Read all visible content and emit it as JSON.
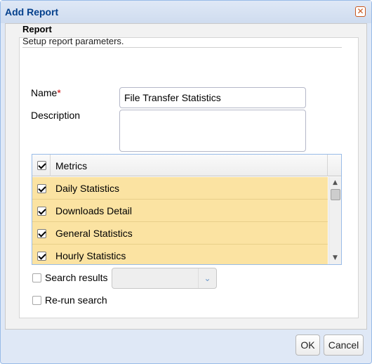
{
  "window": {
    "title": "Add Report",
    "close_glyph": "✕"
  },
  "section": {
    "title": "Report",
    "subtitle": "Setup report parameters."
  },
  "form": {
    "name_label": "Name",
    "required_marker": "*",
    "name_value": "File Transfer Statistics",
    "description_label": "Description",
    "description_value": ""
  },
  "metrics": {
    "header": "Metrics",
    "header_checked": true,
    "rows": [
      {
        "label": "Daily Statistics",
        "checked": true
      },
      {
        "label": "Downloads Detail",
        "checked": true
      },
      {
        "label": "General Statistics",
        "checked": true
      },
      {
        "label": "Hourly Statistics",
        "checked": true
      }
    ],
    "scroll_up": "▲",
    "scroll_down": "▼",
    "row_color": "#fbe3a2"
  },
  "options": {
    "search_results_label": "Search results",
    "search_results_checked": false,
    "search_results_value": "",
    "combo_arrow": "⌄",
    "rerun_label": "Re-run search",
    "rerun_checked": false
  },
  "buttons": {
    "ok": "OK",
    "cancel": "Cancel"
  },
  "colors": {
    "title": "#04408c",
    "accent_border": "#99bbe8",
    "selection": "#fbe3a2"
  }
}
